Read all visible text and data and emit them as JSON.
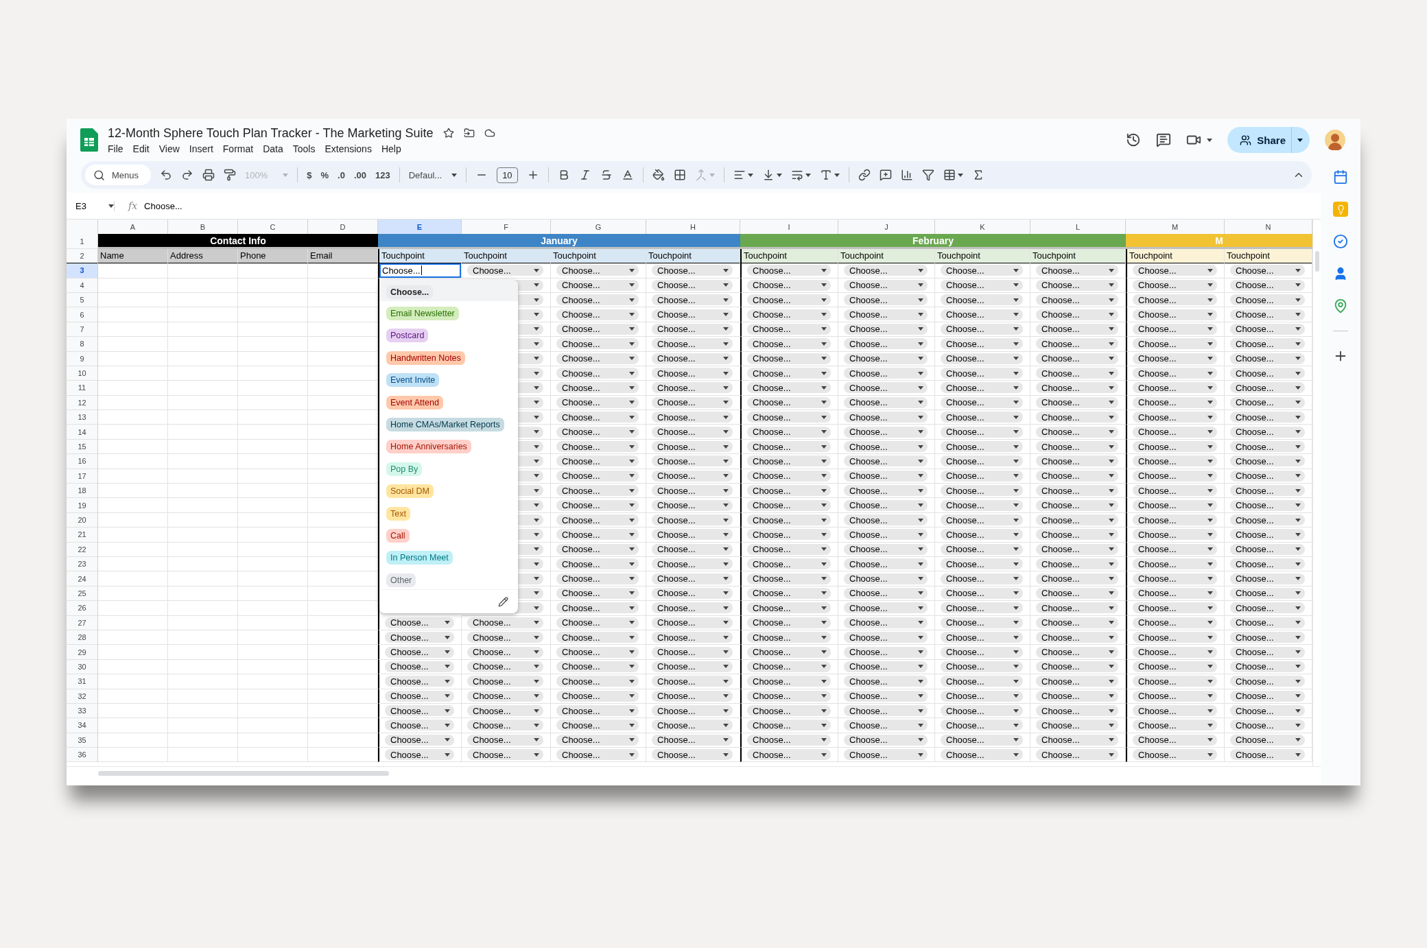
{
  "title": "12-Month Sphere Touch Plan Tracker - The Marketing Suite",
  "menu": [
    "File",
    "Edit",
    "View",
    "Insert",
    "Format",
    "Data",
    "Tools",
    "Extensions",
    "Help"
  ],
  "share_button": "Share",
  "toolbar": {
    "search": "Menus",
    "zoom": "100%",
    "currency": "$",
    "percent": "%",
    "decrease_decimals": ".0",
    "increase_decimals": ".00",
    "number_format": "123",
    "font": "Defaul...",
    "font_size": "10"
  },
  "formula_bar": {
    "cell_ref": "E3",
    "fx": "fx",
    "value": "Choose..."
  },
  "columns": [
    {
      "letter": "A",
      "selected": false
    },
    {
      "letter": "B",
      "selected": false
    },
    {
      "letter": "C",
      "selected": false
    },
    {
      "letter": "D",
      "selected": false
    },
    {
      "letter": "E",
      "selected": true
    },
    {
      "letter": "F",
      "selected": false
    },
    {
      "letter": "G",
      "selected": false
    },
    {
      "letter": "H",
      "selected": false
    },
    {
      "letter": "I",
      "selected": false
    },
    {
      "letter": "J",
      "selected": false
    },
    {
      "letter": "K",
      "selected": false
    },
    {
      "letter": "L",
      "selected": false
    },
    {
      "letter": "M",
      "selected": false
    },
    {
      "letter": "N",
      "selected": false
    }
  ],
  "header_row_numbers": [
    "1",
    "2"
  ],
  "groups": [
    {
      "label": "Contact Info",
      "color": "#000000",
      "headers": [
        "Name",
        "Address",
        "Phone",
        "Email"
      ]
    },
    {
      "label": "January",
      "color": "#3d85c6",
      "headers": [
        "Touchpoint",
        "Touchpoint",
        "Touchpoint",
        "Touchpoint"
      ]
    },
    {
      "label": "February",
      "color": "#6aa84f",
      "headers": [
        "Touchpoint",
        "Touchpoint",
        "Touchpoint",
        "Touchpoint"
      ]
    },
    {
      "label": "M",
      "color": "#f1c232",
      "headers": [
        "Touchpoint",
        "Touchpoint"
      ]
    }
  ],
  "rows": [
    {
      "number": "3",
      "editing": true,
      "cells": [
        "Choose...",
        "Choose...",
        "Choose...",
        "Choose...",
        "Choose...",
        "Choose...",
        "Choose...",
        "Choose...",
        "Choose...",
        "Choose..."
      ]
    },
    {
      "number": "4",
      "editing": false,
      "cells": [
        "Choose...",
        "Choose...",
        "Choose...",
        "Choose...",
        "Choose...",
        "Choose...",
        "Choose...",
        "Choose..."
      ]
    },
    {
      "number": "5",
      "editing": false,
      "cells": [
        "Choose...",
        "Choose...",
        "Choose...",
        "Choose...",
        "Choose...",
        "Choose...",
        "Choose...",
        "Choose..."
      ]
    },
    {
      "number": "6",
      "editing": false,
      "cells": [
        "Choose...",
        "Choose...",
        "Choose...",
        "Choose...",
        "Choose...",
        "Choose...",
        "Choose...",
        "Choose..."
      ]
    },
    {
      "number": "7",
      "editing": false,
      "cells": [
        "Choose...",
        "Choose...",
        "Choose...",
        "Choose...",
        "Choose...",
        "Choose...",
        "Choose...",
        "Choose..."
      ]
    },
    {
      "number": "8",
      "editing": false,
      "cells": [
        "Choose...",
        "Choose...",
        "Choose...",
        "Choose...",
        "Choose...",
        "Choose...",
        "Choose...",
        "Choose..."
      ]
    },
    {
      "number": "9",
      "editing": false,
      "cells": [
        "Choose...",
        "Choose...",
        "Choose...",
        "Choose...",
        "Choose...",
        "Choose...",
        "Choose...",
        "Choose..."
      ]
    },
    {
      "number": "10",
      "editing": false,
      "cells": [
        "Choose...",
        "Choose...",
        "Choose...",
        "Choose...",
        "Choose...",
        "Choose...",
        "Choose...",
        "Choose..."
      ]
    },
    {
      "number": "11",
      "editing": false,
      "cells": [
        "Choose...",
        "Choose...",
        "Choose...",
        "Choose...",
        "Choose...",
        "Choose...",
        "Choose...",
        "Choose..."
      ]
    },
    {
      "number": "12",
      "editing": false,
      "cells": [
        "Choose...",
        "Choose...",
        "Choose...",
        "Choose...",
        "Choose...",
        "Choose...",
        "Choose...",
        "Choose..."
      ]
    },
    {
      "number": "13",
      "editing": false,
      "cells": [
        "Choose...",
        "Choose...",
        "Choose...",
        "Choose...",
        "Choose...",
        "Choose...",
        "Choose...",
        "Choose..."
      ]
    },
    {
      "number": "14",
      "editing": false,
      "cells": [
        "Choose...",
        "Choose...",
        "Choose...",
        "Choose...",
        "Choose...",
        "Choose...",
        "Choose...",
        "Choose..."
      ]
    },
    {
      "number": "15",
      "editing": false,
      "cells": [
        "Choose...",
        "Choose...",
        "Choose...",
        "Choose...",
        "Choose...",
        "Choose...",
        "Choose...",
        "Choose..."
      ]
    },
    {
      "number": "16",
      "editing": false,
      "cells": [
        "Choose...",
        "Choose...",
        "Choose...",
        "Choose...",
        "Choose...",
        "Choose...",
        "Choose...",
        "Choose..."
      ]
    },
    {
      "number": "17",
      "editing": false,
      "cells": [
        "Choose...",
        "Choose...",
        "Choose...",
        "Choose...",
        "Choose...",
        "Choose...",
        "Choose...",
        "Choose..."
      ]
    },
    {
      "number": "18",
      "editing": false,
      "cells": [
        "Choose...",
        "Choose...",
        "Choose...",
        "Choose...",
        "Choose...",
        "Choose...",
        "Choose...",
        "Choose..."
      ]
    },
    {
      "number": "19",
      "editing": false,
      "cells": [
        "Choose...",
        "Choose...",
        "Choose...",
        "Choose...",
        "Choose...",
        "Choose...",
        "Choose...",
        "Choose..."
      ]
    },
    {
      "number": "20",
      "editing": false,
      "cells": [
        "Choose...",
        "Choose...",
        "Choose...",
        "Choose...",
        "Choose...",
        "Choose...",
        "Choose...",
        "Choose..."
      ]
    },
    {
      "number": "21",
      "editing": false,
      "cells": [
        "Choose...",
        "Choose...",
        "Choose...",
        "Choose...",
        "Choose...",
        "Choose...",
        "Choose...",
        "Choose..."
      ]
    },
    {
      "number": "22",
      "editing": false,
      "cells": [
        "Choose...",
        "Choose...",
        "Choose...",
        "Choose...",
        "Choose...",
        "Choose...",
        "Choose...",
        "Choose..."
      ]
    },
    {
      "number": "23",
      "editing": false,
      "cells": [
        "Choose...",
        "Choose...",
        "Choose...",
        "Choose...",
        "Choose...",
        "Choose...",
        "Choose...",
        "Choose..."
      ]
    },
    {
      "number": "24",
      "editing": false,
      "cells": [
        "Choose...",
        "Choose...",
        "Choose...",
        "Choose...",
        "Choose...",
        "Choose...",
        "Choose...",
        "Choose..."
      ]
    },
    {
      "number": "25",
      "editing": false,
      "cells": [
        "Choose...",
        "Choose...",
        "Choose...",
        "Choose...",
        "Choose...",
        "Choose...",
        "Choose...",
        "Choose..."
      ]
    },
    {
      "number": "26",
      "editing": false,
      "cells": [
        "Choose...",
        "Choose...",
        "Choose...",
        "Choose...",
        "Choose...",
        "Choose...",
        "Choose...",
        "Choose..."
      ]
    },
    {
      "number": "27",
      "editing": false,
      "cells": [
        "Choose...",
        "Choose...",
        "Choose...",
        "Choose...",
        "Choose...",
        "Choose...",
        "Choose...",
        "Choose...",
        "Choose...",
        "Choose..."
      ]
    },
    {
      "number": "28",
      "editing": false,
      "cells": [
        "Choose...",
        "Choose...",
        "Choose...",
        "Choose...",
        "Choose...",
        "Choose...",
        "Choose...",
        "Choose...",
        "Choose...",
        "Choose..."
      ]
    },
    {
      "number": "29",
      "editing": false,
      "cells": [
        "Choose...",
        "Choose...",
        "Choose...",
        "Choose...",
        "Choose...",
        "Choose...",
        "Choose...",
        "Choose...",
        "Choose...",
        "Choose..."
      ]
    },
    {
      "number": "30",
      "editing": false,
      "cells": [
        "Choose...",
        "Choose...",
        "Choose...",
        "Choose...",
        "Choose...",
        "Choose...",
        "Choose...",
        "Choose...",
        "Choose...",
        "Choose..."
      ]
    },
    {
      "number": "31",
      "editing": false,
      "cells": [
        "Choose...",
        "Choose...",
        "Choose...",
        "Choose...",
        "Choose...",
        "Choose...",
        "Choose...",
        "Choose...",
        "Choose...",
        "Choose..."
      ]
    },
    {
      "number": "32",
      "editing": false,
      "cells": [
        "Choose...",
        "Choose...",
        "Choose...",
        "Choose...",
        "Choose...",
        "Choose...",
        "Choose...",
        "Choose...",
        "Choose...",
        "Choose..."
      ]
    },
    {
      "number": "33",
      "editing": false,
      "cells": [
        "Choose...",
        "Choose...",
        "Choose...",
        "Choose...",
        "Choose...",
        "Choose...",
        "Choose...",
        "Choose...",
        "Choose...",
        "Choose..."
      ]
    },
    {
      "number": "34",
      "editing": false,
      "cells": [
        "Choose...",
        "Choose...",
        "Choose...",
        "Choose...",
        "Choose...",
        "Choose...",
        "Choose...",
        "Choose...",
        "Choose...",
        "Choose..."
      ]
    },
    {
      "number": "35",
      "editing": false,
      "cells": [
        "Choose...",
        "Choose...",
        "Choose...",
        "Choose...",
        "Choose...",
        "Choose...",
        "Choose...",
        "Choose...",
        "Choose...",
        "Choose..."
      ]
    },
    {
      "number": "36",
      "editing": false,
      "cells": [
        "Choose...",
        "Choose...",
        "Choose...",
        "Choose...",
        "Choose...",
        "Choose...",
        "Choose...",
        "Choose...",
        "Choose...",
        "Choose..."
      ]
    }
  ],
  "dropdown": {
    "header": "Choose...",
    "options": [
      {
        "label": "Email Newsletter",
        "color": "#d4edbc"
      },
      {
        "label": "Postcard",
        "color": "#e6cff2"
      },
      {
        "label": "Handwritten Notes",
        "color": "#ffc8aa"
      },
      {
        "label": "Event Invite",
        "color": "#bfe1f6"
      },
      {
        "label": "Event Attend",
        "color": "#ffc8aa"
      },
      {
        "label": "Home CMAs/Market Reports",
        "color": "#c6dbe1"
      },
      {
        "label": "Home Anniversaries",
        "color": "#ffcfc9"
      },
      {
        "label": "Pop By",
        "color": "#d4f7ec"
      },
      {
        "label": "Social DM",
        "color": "#ffe5a0"
      },
      {
        "label": "Text",
        "color": "#ffe5a0"
      },
      {
        "label": "Call",
        "color": "#ffcfc9"
      },
      {
        "label": "In Person Meet",
        "color": "#bef0f5"
      },
      {
        "label": "Other",
        "color": "#e8eaed"
      }
    ]
  }
}
